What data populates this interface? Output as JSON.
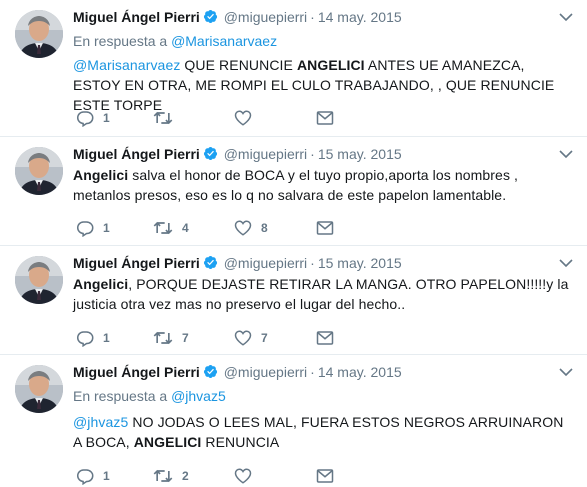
{
  "tweets": [
    {
      "name": "Miguel Ángel Pierri",
      "handle": "@miguepierri",
      "dot": "·",
      "date": "14 may. 2015",
      "reply_prefix": "En respuesta a",
      "reply_to": "@Marisanarvaez",
      "text_mention": "@Marisanarvaez",
      "text_a": " QUE RENUNCIE ",
      "text_bold": "ANGELICI",
      "text_b": " ANTES UE AMANEZCA, ESTOY EN OTRA, ME ROMPI EL CULO TRABAJANDO, , QUE RENUNCIE ESTE TORPE",
      "replies": "1",
      "retweets": "",
      "likes": ""
    },
    {
      "name": "Miguel Ángel Pierri",
      "handle": "@miguepierri",
      "dot": "·",
      "date": "15 may. 2015",
      "text_bold": "Angelici",
      "text_b": " salva el honor de BOCA y el tuyo propio,aporta los nombres , metanlos presos, eso es lo q no salvara de este papelon lamentable.",
      "replies": "1",
      "retweets": "4",
      "likes": "8"
    },
    {
      "name": "Miguel Ángel Pierri",
      "handle": "@miguepierri",
      "dot": "·",
      "date": "15 may. 2015",
      "text_bold": "Angelici",
      "text_b": ", PORQUE DEJASTE RETIRAR LA MANGA. OTRO PAPELON!!!!!y la justicia otra vez mas no preservo el lugar del hecho..",
      "replies": "1",
      "retweets": "7",
      "likes": "7"
    },
    {
      "name": "Miguel Ángel Pierri",
      "handle": "@miguepierri",
      "dot": "·",
      "date": "14 may. 2015",
      "reply_prefix": "En respuesta a",
      "reply_to": "@jhvaz5",
      "text_mention": "@jhvaz5",
      "text_a": " NO JODAS O LEES MAL, FUERA ESTOS NEGROS ARRUINARON A BOCA, ",
      "text_bold": "ANGELICI",
      "text_b": " RENUNCIA",
      "replies": "1",
      "retweets": "2",
      "likes": ""
    }
  ],
  "icons": {
    "verified": "verified-badge-icon",
    "caret": "chevron-down-icon",
    "reply": "reply-icon",
    "retweet": "retweet-icon",
    "like": "heart-icon",
    "dm": "envelope-icon"
  },
  "colors": {
    "accent": "#1b95e0",
    "muted": "#657786",
    "text": "#14171a",
    "verified": "#1da1f2"
  }
}
